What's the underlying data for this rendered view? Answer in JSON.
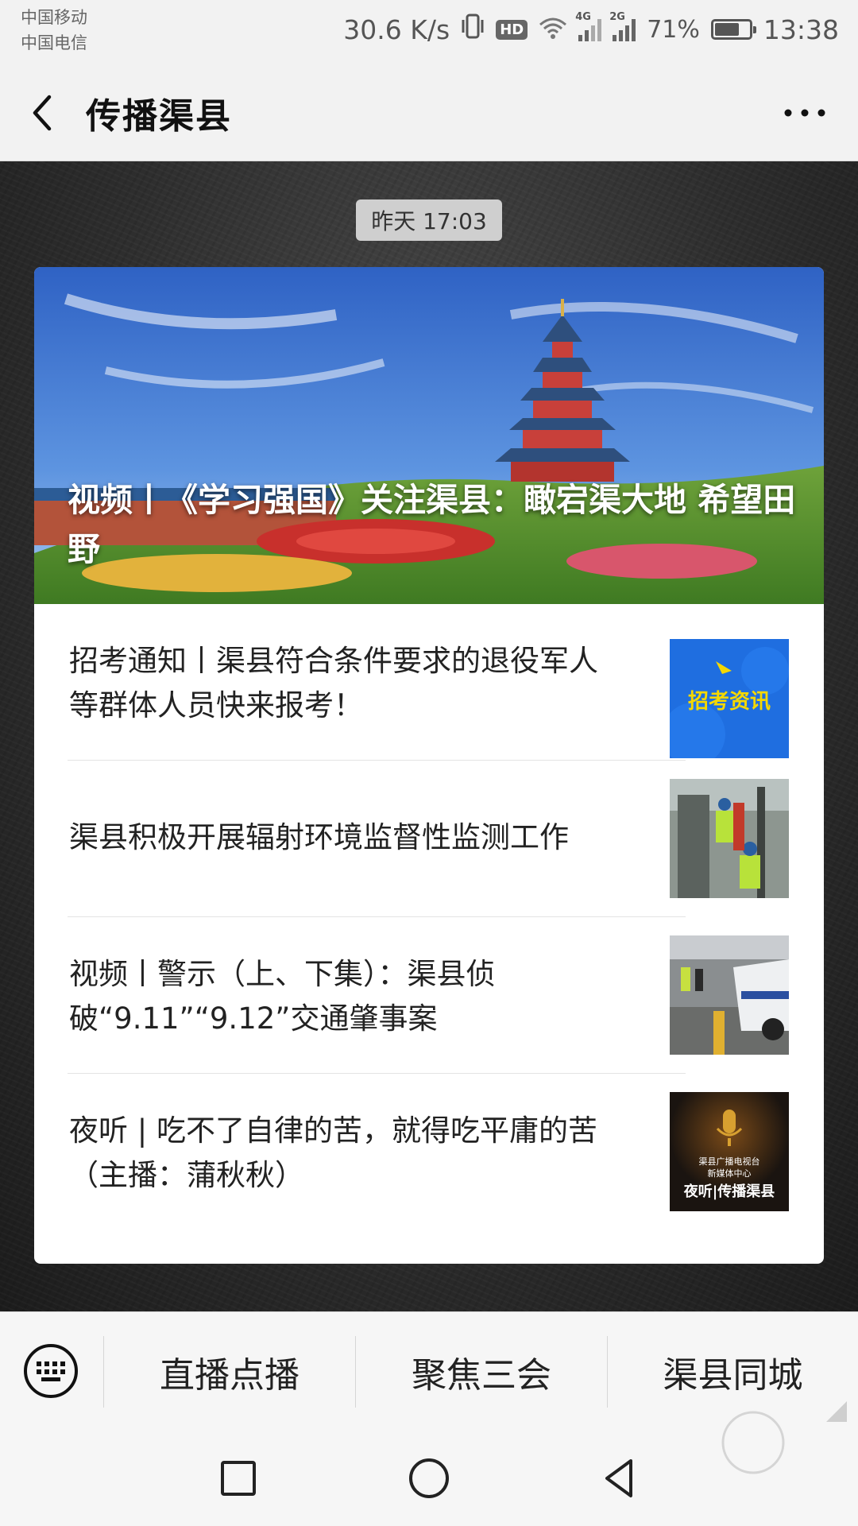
{
  "status_bar": {
    "carrier_1": "中国移动",
    "carrier_2": "中国电信",
    "net_speed": "30.6 K/s",
    "hd_badge": "HD",
    "net_4g": "4G",
    "net_2g": "2G",
    "battery": "71%",
    "battery_level": 0.71,
    "time": "13:38"
  },
  "header": {
    "title": "传播渠县"
  },
  "chat": {
    "timestamp": "昨天 17:03",
    "hero": {
      "title": "视频丨《学习强国》关注渠县：瞰宕渠大地 希望田野"
    },
    "items": [
      {
        "title": "招考通知丨渠县符合条件要求的退役军人等群体人员快来报考！",
        "thumb_text": "招考资讯"
      },
      {
        "title": "渠县积极开展辐射环境监督性监测工作"
      },
      {
        "title": "视频丨警示（上、下集）：渠县侦破“9.11”“9.12”交通肇事案"
      },
      {
        "title": "夜听 | 吃不了自律的苦，就得吃平庸的苦（主播：蒲秋秋）",
        "thumb_line1": "渠县广播电视台",
        "thumb_line2": "新媒体中心",
        "thumb_line3": "夜听|传播渠县"
      }
    ]
  },
  "menu": {
    "items": [
      "直播点播",
      "聚焦三会",
      "渠县同城"
    ]
  },
  "colors": {
    "bg": "#f2f2f2",
    "card": "#ffffff",
    "thumb_blue": "#1f6ee0",
    "thumb_yellow": "#f5d800"
  }
}
